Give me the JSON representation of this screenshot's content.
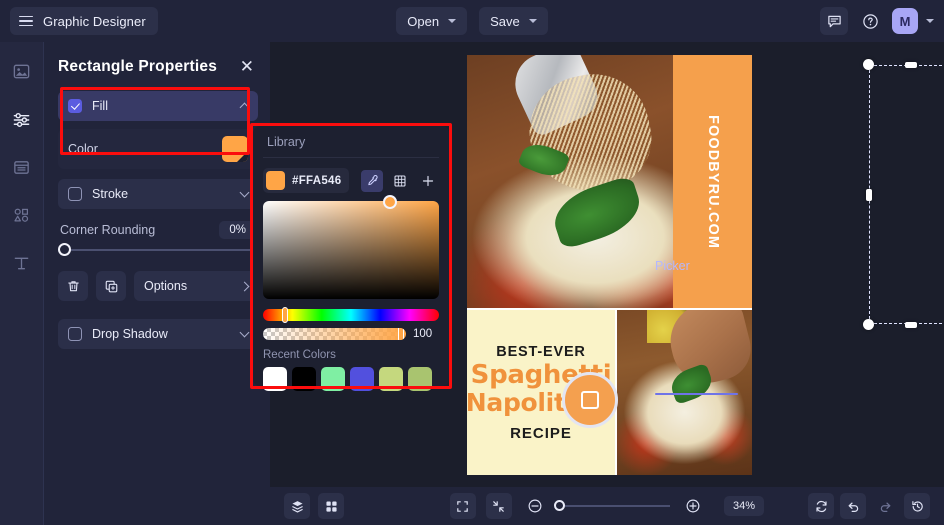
{
  "app": {
    "title": "Graphic Designer",
    "menu_icon": "hamburger-icon"
  },
  "topbar": {
    "open_label": "Open",
    "save_label": "Save",
    "comment_icon": "comment-icon",
    "help_icon": "help-circle-icon",
    "avatar_initial": "M",
    "account_caret": "chevron-down-icon"
  },
  "rail": {
    "items": [
      {
        "name": "image-tool",
        "icon": "image-icon",
        "active": false
      },
      {
        "name": "adjustments-tool",
        "icon": "sliders-icon",
        "active": true
      },
      {
        "name": "page-tool",
        "icon": "page-icon",
        "active": false
      },
      {
        "name": "shapes-tool",
        "icon": "shapes-icon",
        "active": false
      },
      {
        "name": "text-tool",
        "icon": "text-t-icon",
        "active": false
      }
    ]
  },
  "panel": {
    "title": "Rectangle Properties",
    "close_icon": "close-icon",
    "fill": {
      "label": "Fill",
      "checked": true,
      "collapse_icon": "chevron-up-icon",
      "color_label": "Color",
      "color_value": "#FFA546"
    },
    "stroke": {
      "label": "Stroke",
      "checked": false,
      "expand_icon": "chevron-down-icon"
    },
    "corner_rounding": {
      "label": "Corner Rounding",
      "value": "0%"
    },
    "actions": {
      "delete_icon": "trash-icon",
      "duplicate_icon": "duplicate-icon",
      "options_label": "Options",
      "options_icon": "chevron-right-icon"
    },
    "drop_shadow": {
      "label": "Drop Shadow",
      "checked": false,
      "expand_icon": "chevron-down-icon"
    }
  },
  "picker": {
    "tabs": [
      {
        "label": "Picker",
        "selected": true
      },
      {
        "label": "Library",
        "selected": false
      }
    ],
    "hex_value": "#FFA546",
    "eyedropper_icon": "eyedropper-icon",
    "palette_icon": "grid-palette-icon",
    "add_icon": "plus-icon",
    "alpha_value": "100",
    "recent_colors_label": "Recent Colors",
    "recent_colors": [
      "#FFFFFF",
      "#000000",
      "#7FEFA3",
      "#5250DE",
      "#C5D87E",
      "#A9C46F"
    ]
  },
  "canvas": {
    "selected_shape": "orange-banner-rectangle",
    "banner_text": "FOODBYRU.COM",
    "banner_color": "#F5A04C",
    "card": {
      "line1": "BEST-EVER",
      "line2": "Spaghetti",
      "line3": "Napolitana",
      "line4": "RECIPE",
      "background": "#FAF3C8",
      "accent": "#F0923C"
    }
  },
  "bottombar": {
    "layers_icon": "layers-icon",
    "grid_icon": "grid-icon",
    "fit_icon": "fit-frame-icon",
    "shrink_icon": "shrink-icon",
    "zoom_out_icon": "zoom-out-icon",
    "zoom_in_icon": "zoom-in-icon",
    "zoom_level": "34%",
    "refresh_icon": "refresh-icon",
    "undo_icon": "undo-icon",
    "redo_icon": "redo-icon",
    "history_icon": "history-icon"
  }
}
